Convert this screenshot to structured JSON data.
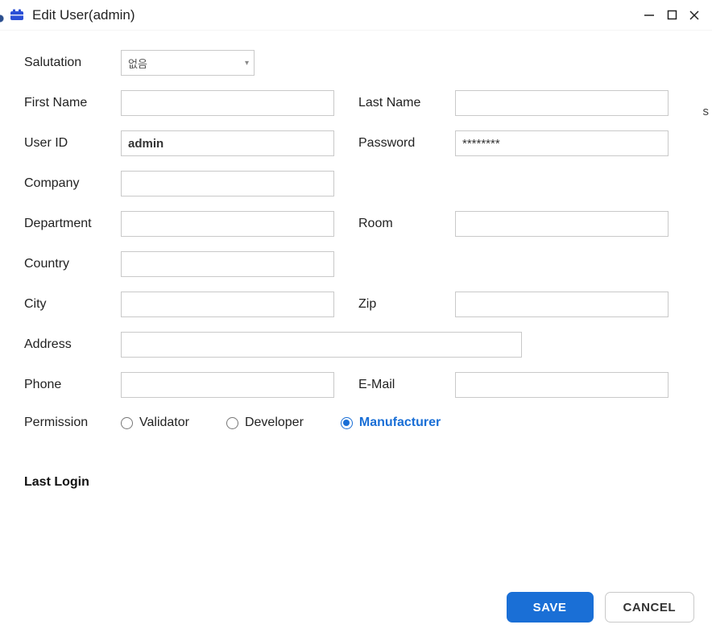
{
  "window": {
    "title": "Edit User(admin)"
  },
  "labels": {
    "salutation": "Salutation",
    "first_name": "First Name",
    "last_name": "Last Name",
    "user_id": "User ID",
    "password": "Password",
    "company": "Company",
    "department": "Department",
    "room": "Room",
    "country": "Country",
    "city": "City",
    "zip": "Zip",
    "address": "Address",
    "phone": "Phone",
    "email": "E-Mail",
    "permission": "Permission",
    "last_login": "Last Login"
  },
  "values": {
    "salutation": "없음",
    "first_name": "",
    "last_name": "",
    "user_id": "admin",
    "password": "********",
    "company": "",
    "department": "",
    "room": "",
    "country": "",
    "city": "",
    "zip": "",
    "address": "",
    "phone": "",
    "email": ""
  },
  "permissions": {
    "validator": "Validator",
    "developer": "Developer",
    "manufacturer": "Manufacturer",
    "selected": "manufacturer"
  },
  "buttons": {
    "save": "SAVE",
    "cancel": "CANCEL"
  },
  "stray_right": "s"
}
